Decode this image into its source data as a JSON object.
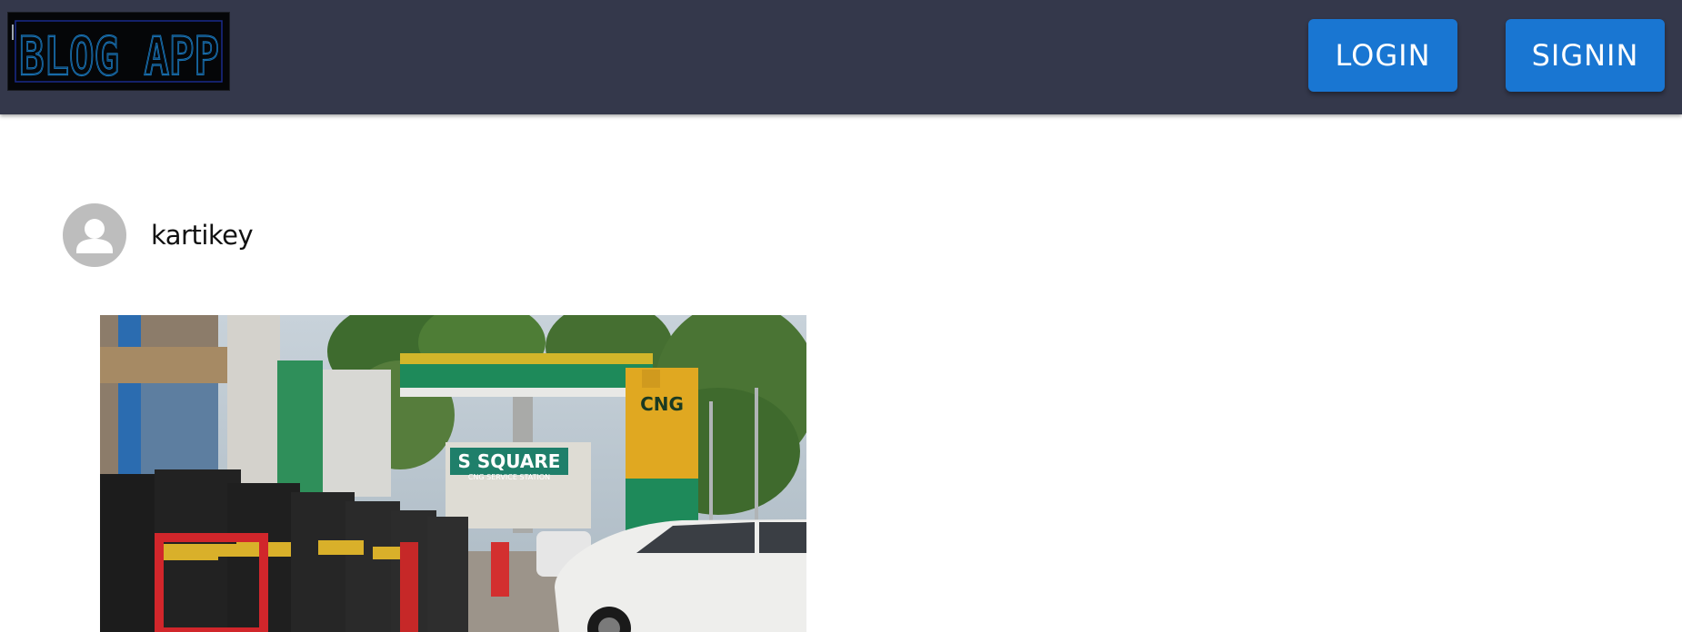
{
  "navbar": {
    "logo_text": "BLOG APP",
    "login_label": "LOGIN",
    "signin_label": "SIGNIN"
  },
  "post": {
    "author": "kartikey",
    "avatar_icon": "person-icon",
    "image_texts": {
      "station_sign": "S SQUARE",
      "station_subtitle": "CNG SERVICE STATION",
      "pylon": "CNG"
    }
  },
  "colors": {
    "navbar": "#34384b",
    "button": "#1976d2",
    "avatar": "#bdbdbd",
    "logo_outline": "#1e88d0"
  }
}
